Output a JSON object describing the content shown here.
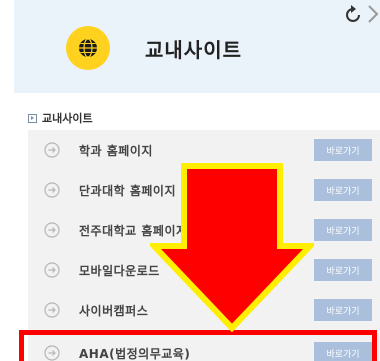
{
  "header": {
    "title": "교내사이트",
    "title_icon": "globe-icon",
    "accent": "#ffd21f",
    "background": "#eaf2fa"
  },
  "section": {
    "label": "교내사이트"
  },
  "items": [
    {
      "label": "학과 홈페이지",
      "button": "바로가기"
    },
    {
      "label": "단과대학 홈페이지",
      "button": "바로가기"
    },
    {
      "label": "전주대학교 홈페이지",
      "button": "바로가기"
    },
    {
      "label": "모바일다운로드",
      "button": "바로가기"
    },
    {
      "label": "사이버캠퍼스",
      "button": "바로가기"
    },
    {
      "label": "AHA(법정의무교육)",
      "button": "바로가기"
    }
  ],
  "annotation": {
    "arrow_color": "#ff0000",
    "arrow_outline": "#ffee00",
    "highlight_color": "#ff0000"
  }
}
